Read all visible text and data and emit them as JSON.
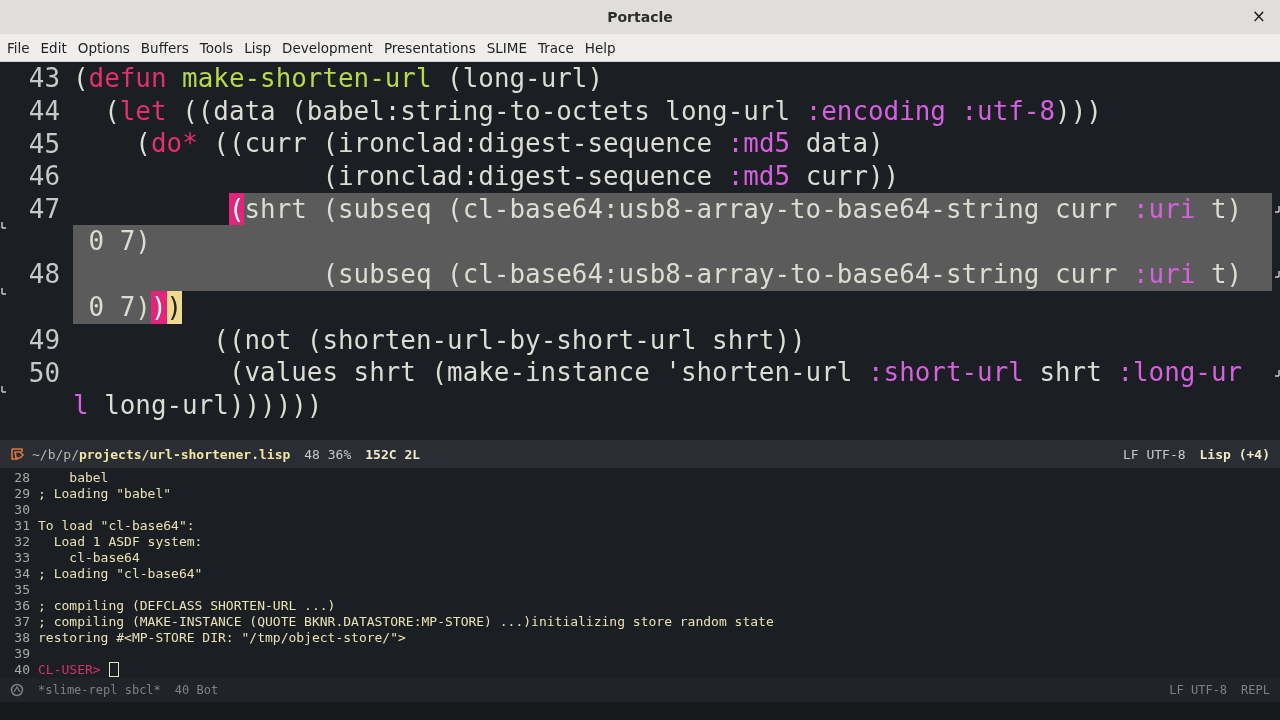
{
  "window": {
    "title": "Portacle",
    "close": "×"
  },
  "menu": [
    "File",
    "Edit",
    "Options",
    "Buffers",
    "Tools",
    "Lisp",
    "Development",
    "Presentations",
    "SLIME",
    "Trace",
    "Help"
  ],
  "editor": {
    "rows": [
      {
        "number": "43",
        "selected": false,
        "selected_to_edge": false,
        "wraps": false,
        "segments": [
          {
            "text": "(",
            "kind": "text"
          },
          {
            "text": "defun",
            "kind": "keyword"
          },
          {
            "text": " make-shorten-url",
            "kind": "defname"
          },
          {
            "text": " (long-url)",
            "kind": "text"
          }
        ]
      },
      {
        "number": "44",
        "selected": false,
        "indent_selected": false,
        "selected_to_edge": false,
        "wraps": false,
        "segments": [
          {
            "text": "  (",
            "kind": "text"
          },
          {
            "text": "let",
            "kind": "keyword"
          },
          {
            "text": " ((data (babel:string-to-octets long-url ",
            "kind": "text"
          },
          {
            "text": ":encoding :utf-8",
            "kind": "keysym"
          },
          {
            "text": ")))",
            "kind": "text"
          }
        ]
      },
      {
        "number": "45",
        "selected": false,
        "indent_selected": false,
        "selected_to_edge": false,
        "wraps": false,
        "segments": [
          {
            "text": "    (",
            "kind": "text"
          },
          {
            "text": "do*",
            "kind": "keyword"
          },
          {
            "text": " ((curr (ironclad:digest-sequence ",
            "kind": "text"
          },
          {
            "text": ":md5",
            "kind": "keysym"
          },
          {
            "text": " data)",
            "kind": "text"
          }
        ]
      },
      {
        "number": "46",
        "selected": false,
        "indent_selected": false,
        "selected_to_edge": false,
        "wraps": false,
        "segments": [
          {
            "text": "                (ironclad:digest-sequence ",
            "kind": "text"
          },
          {
            "text": ":md5",
            "kind": "keysym"
          },
          {
            "text": " curr))",
            "kind": "text"
          }
        ]
      },
      {
        "number": "47",
        "selected": true,
        "indent_selected": false,
        "selected_to_edge": true,
        "wraps": true,
        "segments": [
          {
            "text": "          (",
            "kind": "paren-match"
          },
          {
            "text": "shrt (subseq (cl-base64:usb8-array-to-base64-string curr ",
            "kind": "text"
          },
          {
            "text": ":uri",
            "kind": "keysym"
          },
          {
            "text": " t)",
            "kind": "text"
          }
        ]
      },
      {
        "selected": true,
        "indent_selected": true,
        "selected_to_edge": true,
        "wraps": false,
        "segments": [
          {
            "text": " 0 7)",
            "kind": "text"
          }
        ]
      },
      {
        "number": "48",
        "selected": true,
        "indent_selected": true,
        "selected_to_edge": true,
        "wraps": true,
        "segments": [
          {
            "text": "                (subseq (cl-base64:usb8-array-to-base64-string curr ",
            "kind": "text"
          },
          {
            "text": ":uri",
            "kind": "keysym"
          },
          {
            "text": " t)",
            "kind": "text"
          }
        ]
      },
      {
        "selected": true,
        "indent_selected": true,
        "selected_to_edge": false,
        "wraps": false,
        "segments": [
          {
            "text": " 0 7)",
            "kind": "text"
          },
          {
            "text": ")",
            "kind": "paren-match"
          },
          {
            "text": ")",
            "kind": "cursor"
          }
        ]
      },
      {
        "number": "49",
        "selected": false,
        "indent_selected": false,
        "selected_to_edge": false,
        "wraps": false,
        "segments": [
          {
            "text": "         ((not (shorten-url-by-short-url shrt))",
            "kind": "text"
          }
        ]
      },
      {
        "number": "50",
        "selected": false,
        "indent_selected": false,
        "selected_to_edge": false,
        "wraps": true,
        "segments": [
          {
            "text": "          (values shrt (make-instance 'shorten-url ",
            "kind": "text"
          },
          {
            "text": ":short-url",
            "kind": "keysym"
          },
          {
            "text": " shrt ",
            "kind": "text"
          },
          {
            "text": ":long-ur",
            "kind": "keysym"
          }
        ]
      },
      {
        "selected": false,
        "selected_to_edge": false,
        "wraps": false,
        "segments": [
          {
            "text": "l",
            "kind": "keysym"
          },
          {
            "text": " long-url))))))",
            "kind": "text"
          }
        ]
      }
    ]
  },
  "mode_line": {
    "dir": "~/b/p/",
    "file": "projects/url-shortener.lisp",
    "position": "48 36%",
    "size": "152C 2L",
    "encoding": "LF UTF-8",
    "mode": "Lisp (+4)"
  },
  "repl": {
    "lines": [
      {
        "number": "28",
        "kind": "output",
        "text": "    babel"
      },
      {
        "number": "29",
        "kind": "output",
        "text": "; Loading \"babel\""
      },
      {
        "number": "30",
        "kind": "output"
      },
      {
        "number": "31",
        "kind": "output",
        "text": "To load \"cl-base64\":"
      },
      {
        "number": "32",
        "kind": "output",
        "text": "  Load 1 ASDF system:"
      },
      {
        "number": "33",
        "kind": "output",
        "text": "    cl-base64"
      },
      {
        "number": "34",
        "kind": "output",
        "text": "; Loading \"cl-base64\""
      },
      {
        "number": "35",
        "kind": "output"
      },
      {
        "number": "36",
        "kind": "output",
        "text": "; compiling (DEFCLASS SHORTEN-URL ...)"
      },
      {
        "number": "37",
        "kind": "output",
        "text": "; compiling (MAKE-INSTANCE (QUOTE BKNR.DATASTORE:MP-STORE) ...)initializing store random state"
      },
      {
        "number": "38",
        "kind": "output",
        "text": "restoring #<MP-STORE DIR: \"/tmp/object-store/\">"
      },
      {
        "number": "39",
        "kind": "output"
      },
      {
        "number": "40",
        "kind": "prompt",
        "text": "CL-USER>"
      }
    ]
  },
  "repl_mode_line": {
    "buffer": "*slime-repl sbcl*",
    "position": "40 Bot",
    "encoding": "LF UTF-8",
    "mode": "REPL"
  }
}
